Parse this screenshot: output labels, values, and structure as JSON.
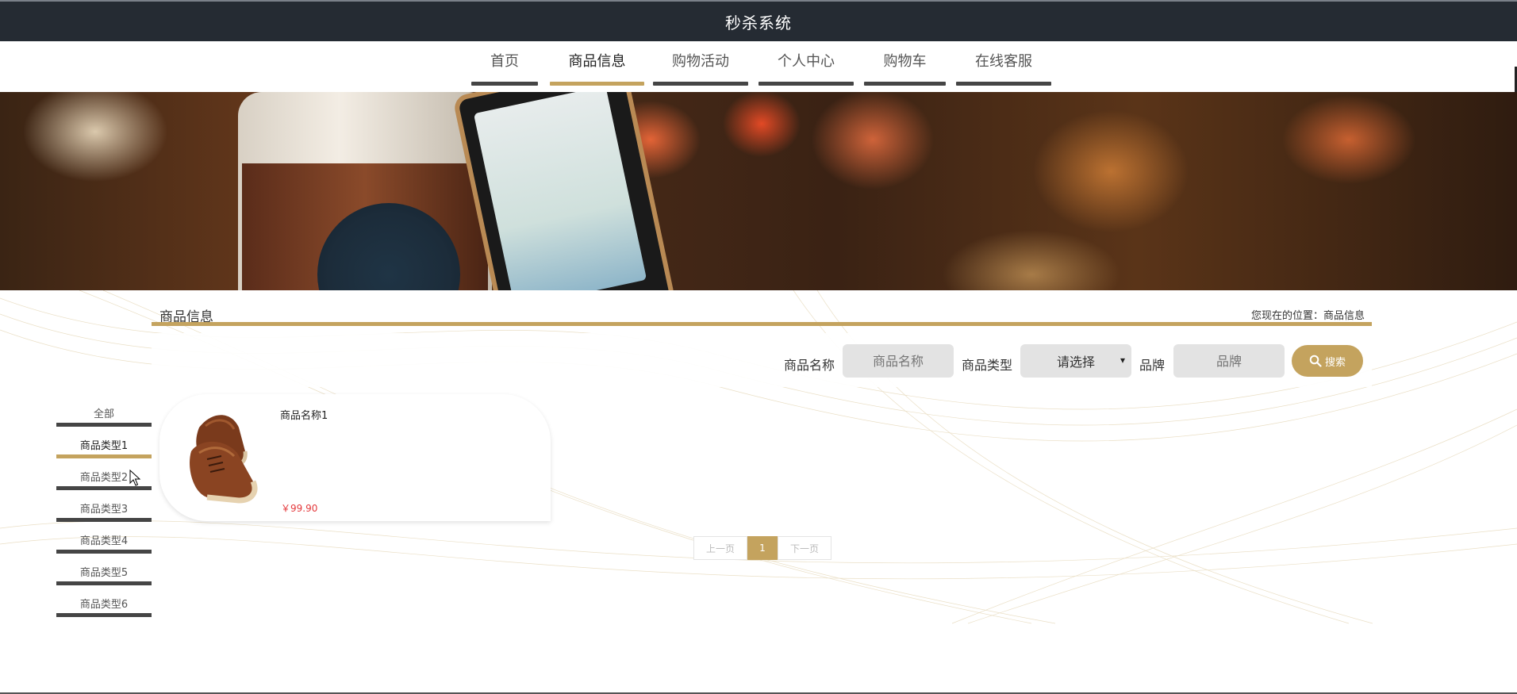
{
  "app": {
    "title": "秒杀系统"
  },
  "nav": {
    "items": [
      {
        "label": "首页",
        "active": false
      },
      {
        "label": "商品信息",
        "active": true
      },
      {
        "label": "购物活动",
        "active": false
      },
      {
        "label": "个人中心",
        "active": false
      },
      {
        "label": "购物车",
        "active": false
      },
      {
        "label": "在线客服",
        "active": false
      }
    ]
  },
  "section": {
    "title": "商品信息",
    "breadcrumb": "您现在的位置：商品信息"
  },
  "search": {
    "name_label": "商品名称",
    "name_placeholder": "商品名称",
    "type_label": "商品类型",
    "type_selected": "请选择",
    "brand_label": "品牌",
    "brand_placeholder": "品牌",
    "button_label": "搜索"
  },
  "categories": [
    {
      "label": "全部",
      "active": false
    },
    {
      "label": "商品类型1",
      "active": true
    },
    {
      "label": "商品类型2",
      "active": false
    },
    {
      "label": "商品类型3",
      "active": false
    },
    {
      "label": "商品类型4",
      "active": false
    },
    {
      "label": "商品类型5",
      "active": false
    },
    {
      "label": "商品类型6",
      "active": false
    }
  ],
  "products": [
    {
      "name": "商品名称1",
      "price": "￥99.90",
      "image": "brown-leather-shoes"
    }
  ],
  "pagination": {
    "prev": "上一页",
    "current": "1",
    "next": "下一页"
  },
  "colors": {
    "accent": "#c4a35e",
    "topbar": "#252b33",
    "price": "#e4393c",
    "bar": "#454545"
  }
}
